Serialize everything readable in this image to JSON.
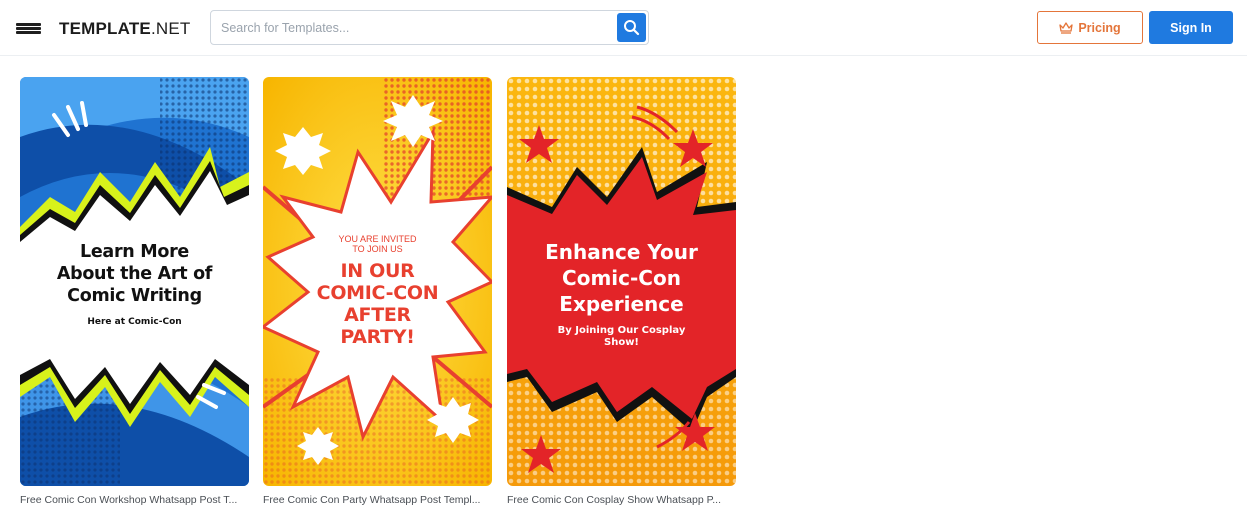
{
  "header": {
    "logo_bold": "TEMPLATE",
    "logo_suffix": ".NET",
    "search_placeholder": "Search for Templates...",
    "pricing_label": "Pricing",
    "signin_label": "Sign In"
  },
  "colors": {
    "accent_blue": "#1f7ae0",
    "pricing_orange": "#e4753a"
  },
  "templates": [
    {
      "caption": "Free Comic Con Workshop Whatsapp Post T...",
      "lines": [
        "Learn More",
        "About the Art of",
        "Comic Writing"
      ],
      "subline": "Here at Comic-Con"
    },
    {
      "caption": "Free Comic Con Party Whatsapp Post Templ...",
      "kicker": [
        "YOU ARE INVITED",
        "TO JOIN US"
      ],
      "lines": [
        "IN OUR",
        "COMIC-CON",
        "AFTER",
        "PARTY!"
      ]
    },
    {
      "caption": "Free Comic Con Cosplay Show Whatsapp P...",
      "lines": [
        "Enhance Your",
        "Comic-Con",
        "Experience"
      ],
      "sublines": [
        "By Joining Our Cosplay",
        "Show!"
      ]
    }
  ]
}
